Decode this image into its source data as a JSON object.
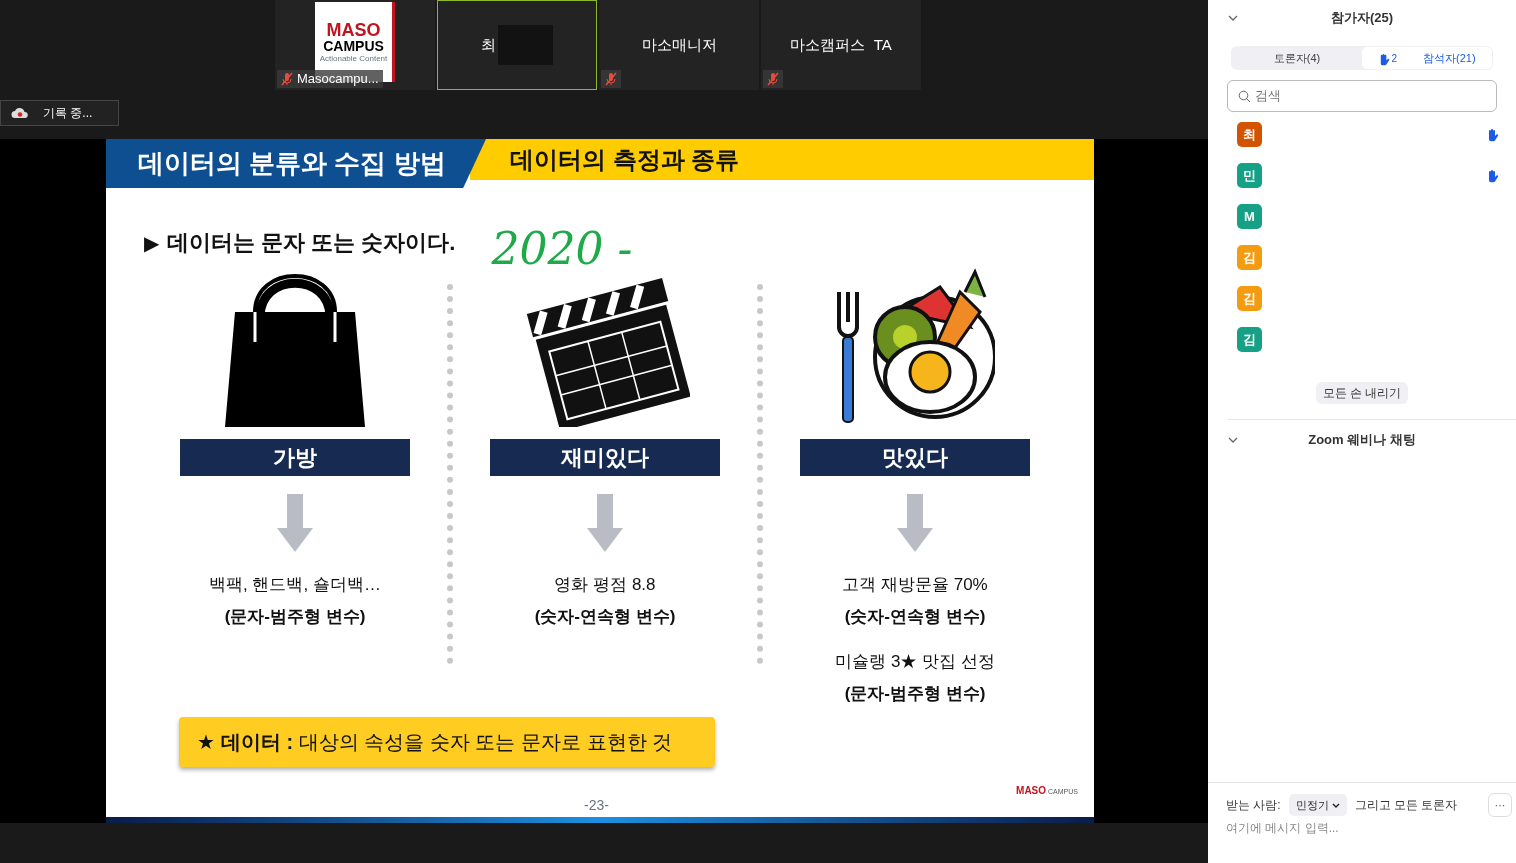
{
  "videos": [
    {
      "kind": "logo",
      "logo_top": "MASO",
      "logo_mid": "CAMPUS",
      "logo_sub": "Actionable Content",
      "name": "Masocampu...",
      "muted": true,
      "selected": false
    },
    {
      "kind": "name",
      "name": "최",
      "muted": false,
      "selected": true
    },
    {
      "kind": "name",
      "name": "마소매니저",
      "muted": true,
      "selected": false
    },
    {
      "kind": "name",
      "name": "마소캠퍼스  TA",
      "muted": true,
      "selected": false
    }
  ],
  "recording": "기록 중...",
  "slide": {
    "title_left": "데이터의 분류와 수집 방법",
    "title_right": "데이터의 측정과 종류",
    "statement_marker": "▶",
    "statement": "데이터는 문자 또는 숫자이다.",
    "annotation": "2020 -",
    "columns": [
      {
        "kind": "bag",
        "label": "가방",
        "lines": [
          {
            "text": "백팩, 핸드백, 숄더백…",
            "bold": false
          },
          {
            "text": "(문자-범주형 변수)",
            "bold": true
          }
        ]
      },
      {
        "kind": "clapper",
        "label": "재미있다",
        "lines": [
          {
            "text": "영화 평점 8.8",
            "bold": false
          },
          {
            "text": "(숫자-연속형 변수)",
            "bold": true
          }
        ]
      },
      {
        "kind": "food",
        "label": "맛있다",
        "lines": [
          {
            "text": "고객 재방문율 70%",
            "bold": false
          },
          {
            "text": "(숫자-연속형 변수)",
            "bold": true
          },
          {
            "text": "미슐랭 3★ 맛집 선정",
            "bold": false
          },
          {
            "text": "(문자-범주형 변수)",
            "bold": true
          }
        ]
      }
    ],
    "callout_star": "★",
    "callout_term": "데이터 :",
    "callout_text": "대상의 속성을 숫자 또는 문자로 표현한 것",
    "page": "-23-",
    "logo_main": "MASO",
    "logo_sub": "CAMPUS"
  },
  "panel": {
    "title": "참가자(25)",
    "tabs": [
      {
        "label": "토론자(4)",
        "selected": false
      },
      {
        "label": "참석자(21)",
        "selected": true,
        "hands": "2"
      }
    ],
    "search": {
      "placeholder": "검색"
    },
    "participants": [
      {
        "initial": "최",
        "color": "#d35400",
        "hand": true
      },
      {
        "initial": "민",
        "color": "#16a085",
        "hand": true
      },
      {
        "initial": "M",
        "color": "#16a085",
        "hand": false
      },
      {
        "initial": "김",
        "color": "#f39c12",
        "hand": false
      },
      {
        "initial": "김",
        "color": "#f39c12",
        "hand": false
      },
      {
        "initial": "김",
        "color": "#16a085",
        "hand": false
      }
    ],
    "lower_hands": "모든 손 내리기",
    "chat_title": "Zoom 웨비나 채팅",
    "to_label": "받는 사람:",
    "to_value": "민정기",
    "to_suffix": "그리고 모든 토론자",
    "more": "···",
    "message": {
      "placeholder": "여기에 메시지 입력..."
    }
  }
}
